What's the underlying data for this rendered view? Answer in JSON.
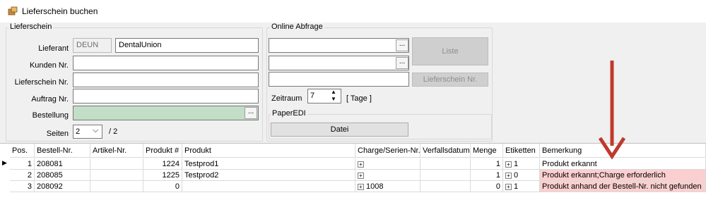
{
  "window": {
    "title": "Lieferschein buchen"
  },
  "lieferschein": {
    "legend": "Lieferschein",
    "lieferant_label": "Lieferant",
    "lieferant_code": "DEUN",
    "lieferant_name": "DentalUnion",
    "kunden_label": "Kunden Nr.",
    "lieferschein_label": "Lieferschein Nr.",
    "auftrag_label": "Auftrag Nr.",
    "bestellung_label": "Bestellung",
    "seiten_label": "Seiten",
    "seiten_value": "2",
    "seiten_total": "/ 2"
  },
  "online": {
    "legend": "Online Abfrage",
    "liste_button": "Liste",
    "lieferschein_button": "Lieferschein Nr.",
    "zeitraum_label": "Zeitraum",
    "zeitraum_value": "7",
    "zeitraum_unit": "[ Tage ]",
    "ellipsis": "..."
  },
  "paperedi": {
    "legend": "PaperEDI",
    "datei_button": "Datei"
  },
  "grid": {
    "headers": [
      "Pos.",
      "Bestell-Nr.",
      "Artikel-Nr.",
      "Produkt #",
      "Produkt",
      "Charge/Serien-Nr.",
      "Verfallsdatum",
      "Menge",
      "Etiketten",
      "Bemerkung"
    ],
    "rows": [
      {
        "pos": "1",
        "bestell": "208081",
        "artikel": "",
        "produkt_nr": "1224",
        "produkt": "Testprod1",
        "charge": "",
        "verfall": "",
        "menge": "1",
        "etiketten": "1",
        "bemerkung": "Produkt erkannt",
        "highlight": false
      },
      {
        "pos": "2",
        "bestell": "208085",
        "artikel": "",
        "produkt_nr": "1225",
        "produkt": "Testprod2",
        "charge": "",
        "verfall": "",
        "menge": "1",
        "etiketten": "0",
        "bemerkung": "Produkt erkannt;Charge erforderlich",
        "highlight": true
      },
      {
        "pos": "3",
        "bestell": "208092",
        "artikel": "",
        "produkt_nr": "0",
        "produkt": "",
        "charge": "1008",
        "verfall": "",
        "menge": "0",
        "etiketten": "1",
        "bemerkung": "Produkt anhand der Bestell-Nr. nicht gefunden",
        "highlight": true
      }
    ]
  },
  "colors": {
    "highlight": "#fbcfcf",
    "arrow": "#c0392b",
    "green_field": "#c2dec6"
  }
}
